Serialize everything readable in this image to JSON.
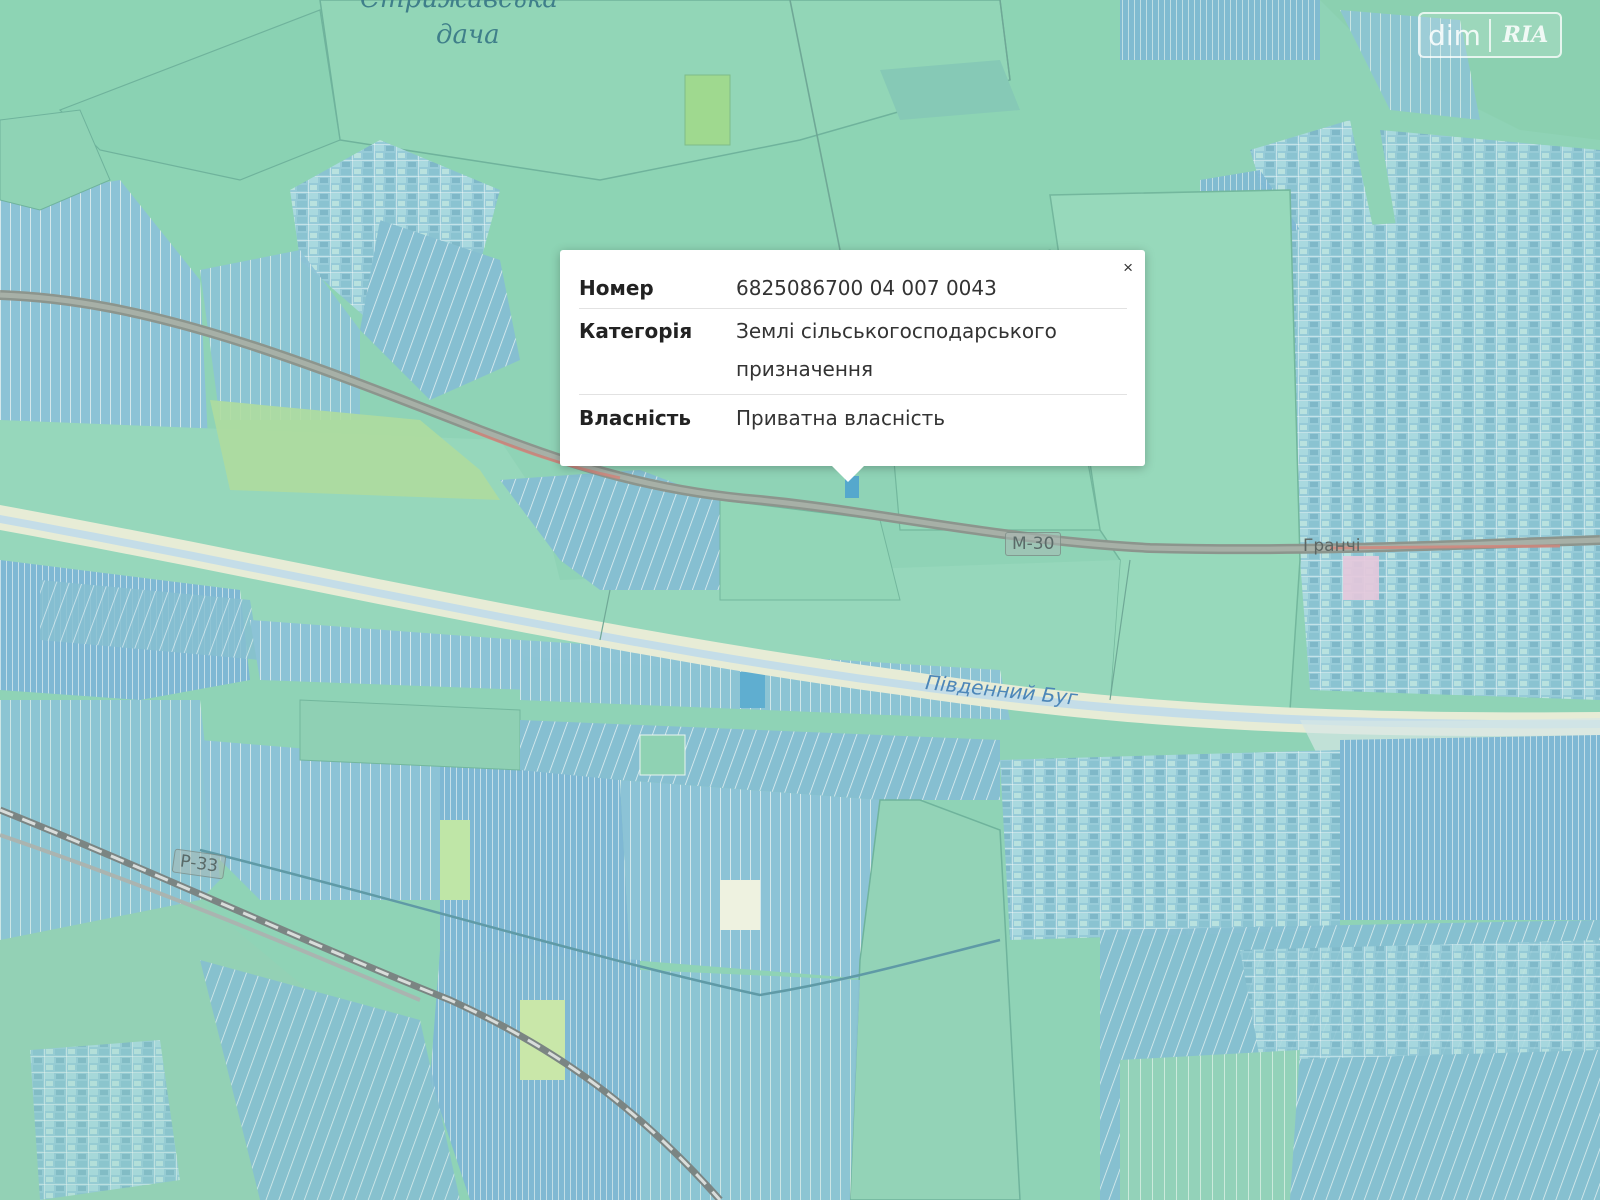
{
  "map": {
    "colors": {
      "background": "#8fd3b6",
      "parcel_blue": "#8fc4d8",
      "parcel_green": "#95d6bb",
      "road": "#8b948c",
      "river": "#c9dfe6",
      "sand": "#e6ecd8"
    },
    "labels": {
      "place_top": "Стрижавська",
      "place_top_2": "дача",
      "river": "Південний Буг",
      "road_m30": "М-30",
      "road_left": "Р-33",
      "village": "Гранчі"
    }
  },
  "popup": {
    "rows": [
      {
        "key": "Номер",
        "value": "6825086700 04 007 0043"
      },
      {
        "key": "Категорія",
        "value": "Землі сільськогосподарського призначення"
      },
      {
        "key": "Власність",
        "value": "Приватна власність"
      }
    ],
    "close_icon": "×"
  },
  "watermark": {
    "left": "dim",
    "right": "RIA"
  }
}
